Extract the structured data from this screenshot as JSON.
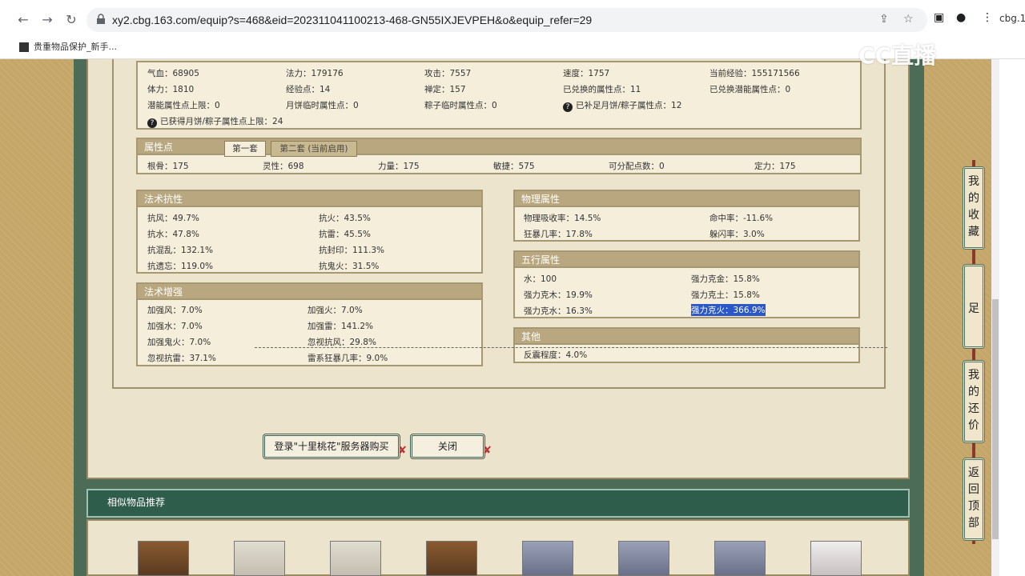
{
  "browser": {
    "url": "xy2.cbg.163.com/equip?s=468&eid=202311041100213-468-GN55IXJEVPEH&o&equip_refer=29",
    "bookmark": "贵重物品保护_新手...",
    "side_tab": "cbg.1"
  },
  "overlay_logo": "CC直播",
  "stats": {
    "rows": [
      [
        "气血：68905",
        "法力：179176",
        "攻击：7557",
        "速度：1757",
        "当前经验：155171566"
      ],
      [
        "体力：1810",
        "经验点：14",
        "禅定：157",
        "已兑换的属性点：11",
        "已兑换潜能属性点：0"
      ],
      [
        "潜能属性点上限：0",
        "月饼临时属性点：0",
        "粽子临时属性点：0",
        "已补足月饼/粽子属性点：12"
      ]
    ],
    "extra": "已获得月饼/粽子属性点上限：24"
  },
  "attr": {
    "title": "属性点",
    "tab1": "第一套",
    "tab2": "第二套 (当前启用)",
    "values": [
      "根骨：175",
      "灵性：698",
      "力量：175",
      "敏捷：575",
      "可分配点数：0",
      "定力：175"
    ]
  },
  "resist": {
    "title": "法术抗性",
    "items": [
      "抗风：49.7%",
      "抗火：43.5%",
      "抗水：47.8%",
      "抗雷：45.5%",
      "抗混乱：132.1%",
      "抗封印：111.3%",
      "抗遗忘：119.0%",
      "抗鬼火：31.5%"
    ]
  },
  "enhance": {
    "title": "法术增强",
    "items": [
      "加强风：7.0%",
      "加强火：7.0%",
      "加强水：7.0%",
      "加强雷：141.2%",
      "加强鬼火：7.0%",
      "忽视抗风：29.8%",
      "忽视抗雷：37.1%",
      "雷系狂暴几率：9.0%"
    ]
  },
  "physical": {
    "title": "物理属性",
    "items": [
      "物理吸收率：14.5%",
      "命中率：-11.6%",
      "狂暴几率：17.8%",
      "躲闪率：3.0%"
    ]
  },
  "wuxing": {
    "title": "五行属性",
    "items": [
      "水：100",
      "强力克金：15.8%",
      "强力克木：19.9%",
      "强力克土：15.8%",
      "强力克水：16.3%",
      "强力克火：366.9%"
    ]
  },
  "other": {
    "title": "其他",
    "items": [
      "反震程度：4.0%"
    ]
  },
  "buttons": {
    "login": "登录\"十里桃花\"服务器购买",
    "close": "关闭"
  },
  "recommend": {
    "title": "相似物品推荐"
  },
  "side_nav": [
    "我的收藏",
    "足迹",
    "我的还价",
    "返回顶部"
  ],
  "colors": {
    "highlight": "#2a58c8",
    "header_bg": "#b9a77f",
    "frame_green": "#2f5d4c"
  }
}
